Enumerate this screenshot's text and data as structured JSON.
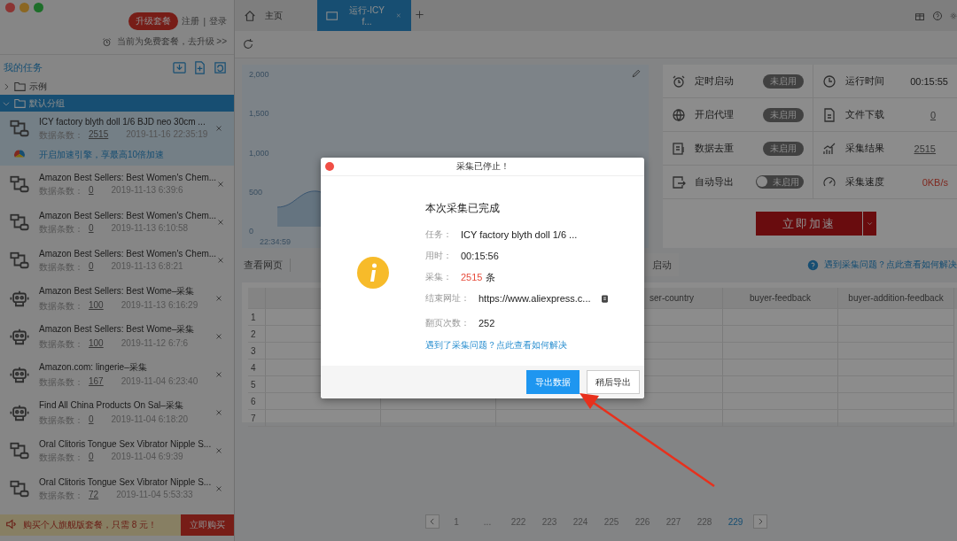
{
  "window": {
    "controls": [
      {
        "color": "#8b3533"
      },
      {
        "color": "#8b6723"
      },
      {
        "color": "#1d6e29"
      }
    ]
  },
  "account": {
    "upgrade_button": "升级套餐",
    "register": "注册",
    "separator": "|",
    "login": "登录",
    "notice": "当前为免费套餐，去升级 >>"
  },
  "sidebar": {
    "title": "我的任务",
    "groups": [
      {
        "label": "示例",
        "expanded": false,
        "selected": false
      },
      {
        "label": "默认分组",
        "expanded": true,
        "selected": true,
        "tasks": [
          {
            "kind": "flow",
            "title": "ICY factory blyth doll 1/6 BJD neo 30cm ...",
            "count_label": "数据条数：",
            "count": "2515",
            "date": "2019-11-16 22:35:19",
            "selected": true,
            "boost": "开启加速引擎，享最高10倍加速"
          },
          {
            "kind": "flow",
            "title": "Amazon Best Sellers: Best Women's Chem...",
            "count_label": "数据条数：",
            "count": "0",
            "date": "2019-11-13 6:39:6",
            "selected": false
          },
          {
            "kind": "flow",
            "title": "Amazon Best Sellers: Best Women's Chem...",
            "count_label": "数据条数：",
            "count": "0",
            "date": "2019-11-13 6:10:58",
            "selected": false
          },
          {
            "kind": "flow",
            "title": "Amazon Best Sellers: Best Women's Chem...",
            "count_label": "数据条数：",
            "count": "0",
            "date": "2019-11-13 6:8:21",
            "selected": false
          },
          {
            "kind": "robot",
            "title": "Amazon Best Sellers: Best Wome–采集",
            "count_label": "数据条数：",
            "count": "100",
            "date": "2019-11-13 6:16:29",
            "selected": false
          },
          {
            "kind": "robot",
            "title": "Amazon Best Sellers: Best Wome–采集",
            "count_label": "数据条数：",
            "count": "100",
            "date": "2019-11-12 6:7:6",
            "selected": false
          },
          {
            "kind": "robot",
            "title": "Amazon.com: lingerie–采集",
            "count_label": "数据条数：",
            "count": "167",
            "date": "2019-11-04 6:23:40",
            "selected": false
          },
          {
            "kind": "robot",
            "title": "Find All China Products On Sal–采集",
            "count_label": "数据条数：",
            "count": "0",
            "date": "2019-11-04 6:18:20",
            "selected": false
          },
          {
            "kind": "flow",
            "title": "Oral Clitoris Tongue Sex Vibrator Nipple S...",
            "count_label": "数据条数：",
            "count": "0",
            "date": "2019-11-04 6:9:39",
            "selected": false
          },
          {
            "kind": "flow",
            "title": "Oral Clitoris Tongue Sex Vibrator Nipple S...",
            "count_label": "数据条数：",
            "count": "72",
            "date": "2019-11-04 5:53:33",
            "selected": false
          }
        ]
      }
    ],
    "promo": {
      "text": "购买个人旗舰版套餐，只需 8 元！",
      "button": "立即购买"
    }
  },
  "tabs": [
    {
      "kind": "home",
      "label": "主页",
      "selected": false
    },
    {
      "kind": "task",
      "label": "运行-ICY f...",
      "selected": true
    }
  ],
  "chart": {
    "y_labels": [
      "2,000",
      "1,500",
      "1,000",
      "500",
      "0"
    ],
    "x_label": "22:34:59"
  },
  "settings": [
    {
      "kind": "badge",
      "label": "定时启动",
      "on": false,
      "state": "未启用"
    },
    {
      "kind": "badge",
      "label": "开启代理",
      "on": false,
      "state": "未启用"
    },
    {
      "kind": "badge",
      "label": "数据去重",
      "on": false,
      "state": "未启用"
    },
    {
      "kind": "switch",
      "label": "自动导出",
      "on": false,
      "state": "未启用"
    }
  ],
  "stats": [
    {
      "kind": "plain",
      "label": "运行时间",
      "value": "00:15:55"
    },
    {
      "kind": "link",
      "label": "文件下载",
      "value": "0"
    },
    {
      "kind": "link",
      "label": "采集结果",
      "value": "2515"
    },
    {
      "kind": "alert",
      "label": "采集速度",
      "value": "0KB/s"
    }
  ],
  "boost_button": "立即加速",
  "view_tab": "查看网页",
  "start_button": "启动",
  "help_link": "遇到采集问题？点此查看如何解决",
  "table": {
    "columns": [
      "ser-country",
      "buyer-feedback",
      "buyer-addition-feedback"
    ],
    "rows": [
      "1",
      "2",
      "3",
      "4",
      "5",
      "6",
      "7"
    ]
  },
  "pagination": {
    "pages": [
      {
        "label": "1",
        "selected": false
      },
      {
        "label": "...",
        "selected": false
      },
      {
        "label": "222",
        "selected": false
      },
      {
        "label": "223",
        "selected": false
      },
      {
        "label": "224",
        "selected": false
      },
      {
        "label": "225",
        "selected": false
      },
      {
        "label": "226",
        "selected": false
      },
      {
        "label": "227",
        "selected": false
      },
      {
        "label": "228",
        "selected": false
      },
      {
        "label": "229",
        "selected": true
      }
    ]
  },
  "dialog": {
    "title": "采集已停止！",
    "heading": "本次采集已完成",
    "fields": [
      {
        "kind": "text",
        "label": "任务：",
        "value": "ICY factory blyth doll 1/6 ..."
      },
      {
        "kind": "text",
        "label": "用时：",
        "value": "00:15:56"
      },
      {
        "kind": "count",
        "label": "采集：",
        "value": "2515",
        "unit": "条"
      },
      {
        "kind": "url",
        "label": "结束网址：",
        "value": "https://www.aliexpress.c..."
      },
      {
        "kind": "text",
        "label": "翻页次数：",
        "value": "252"
      }
    ],
    "link": "遇到了采集问题？点此查看如何解决",
    "buttons": [
      {
        "kind": "primary",
        "label": "导出数据"
      },
      {
        "kind": "secondary",
        "label": "稍后导出"
      }
    ]
  }
}
